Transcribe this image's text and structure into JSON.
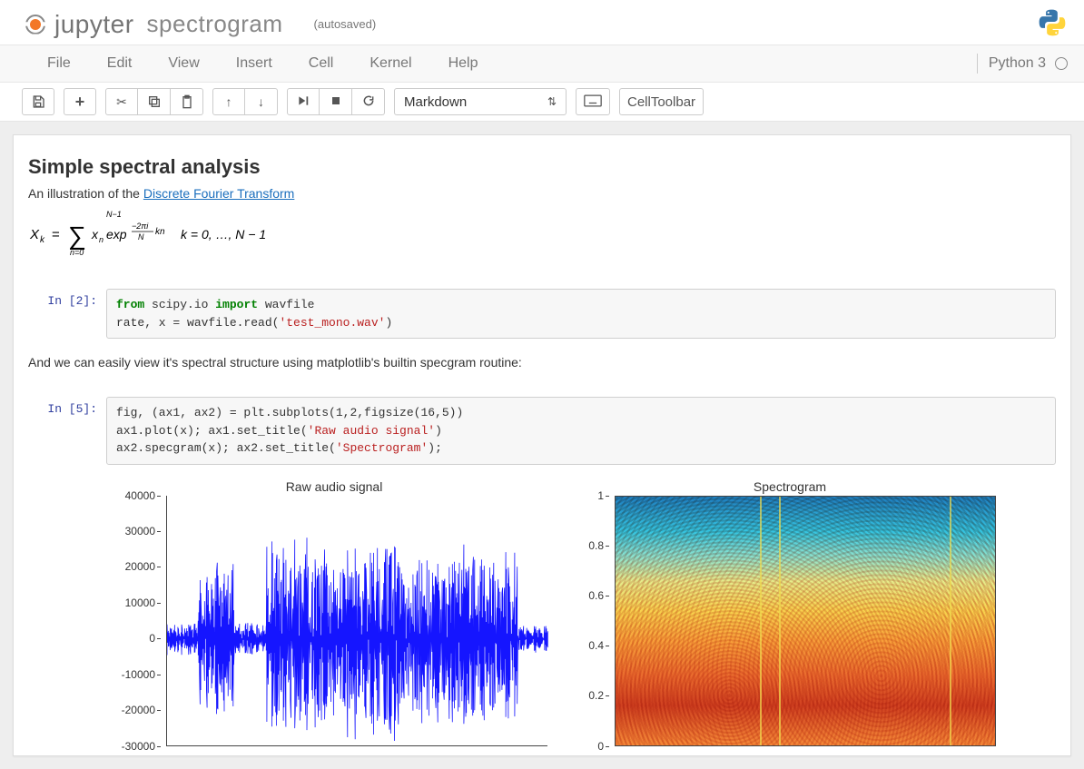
{
  "header": {
    "brand": "jupyter",
    "notebook_title": "spectrogram",
    "autosave_status": "(autosaved)"
  },
  "menubar": {
    "items": [
      "File",
      "Edit",
      "View",
      "Insert",
      "Cell",
      "Kernel",
      "Help"
    ],
    "kernel_name": "Python 3"
  },
  "toolbar": {
    "save_title": "Save and Checkpoint",
    "insert_below_title": "Insert cell below",
    "cut_title": "Cut selected cell",
    "copy_title": "Copy selected cell",
    "paste_title": "Paste cell below",
    "move_up_title": "Move cell up",
    "move_down_title": "Move cell down",
    "run_title": "Run cell, select below",
    "interrupt_title": "Interrupt kernel",
    "restart_title": "Restart kernel",
    "celltype_value": "Markdown",
    "cmd_palette_title": "Open command palette",
    "cell_toolbar_label": "CellToolbar"
  },
  "cells": {
    "markdown1": {
      "heading": "Simple spectral analysis",
      "intro_prefix": "An illustration of the ",
      "intro_link_text": "Discrete Fourier Transform",
      "formula_uplabel": "N−1",
      "formula_sumlabel": "n=0",
      "formula_range": "k = 0, …, N − 1"
    },
    "code1": {
      "prompt": "In [2]:",
      "line1_pre": "from",
      "line1_mod": " scipy.io ",
      "line1_imp": "import",
      "line1_post": " wavfile",
      "line2_a": "rate, x = wavfile.read(",
      "line2_str": "'test_mono.wav'",
      "line2_b": ")"
    },
    "markdown2": {
      "text": "And we can easily view it's spectral structure using matplotlib's builtin specgram routine:"
    },
    "code2": {
      "prompt": "In [5]:",
      "line1": "fig, (ax1, ax2) = plt.subplots(1,2,figsize(16,5))",
      "line2_a": "ax1.plot(x); ax1.set_title(",
      "line2_str": "'Raw audio signal'",
      "line2_b": ")",
      "line3_a": "ax2.specgram(x); ax2.set_title(",
      "line3_str": "'Spectrogram'",
      "line3_b": ");"
    },
    "output": {
      "plot1_title": "Raw audio signal",
      "plot2_title": "Spectrogram"
    }
  },
  "chart_data": [
    {
      "type": "line",
      "title": "Raw audio signal",
      "xlabel": "",
      "ylabel": "",
      "ylim": [
        -30000,
        40000
      ],
      "y_ticks": [
        40000,
        30000,
        20000,
        10000,
        0,
        -10000,
        -20000,
        -30000
      ],
      "note": "Dense waveform amplitude vs. sample index; values oscillate roughly between -30000 and 30000 with denser bursts mid-signal."
    },
    {
      "type": "heatmap",
      "title": "Spectrogram",
      "xlabel": "",
      "ylabel": "",
      "ylim": [
        0.0,
        1.0
      ],
      "y_ticks": [
        1.0,
        0.8,
        0.6,
        0.4,
        0.2,
        0.0
      ],
      "note": "Power spectral density over time; higher intensity (red/orange) at low normalized frequencies, blue at high frequencies."
    }
  ]
}
